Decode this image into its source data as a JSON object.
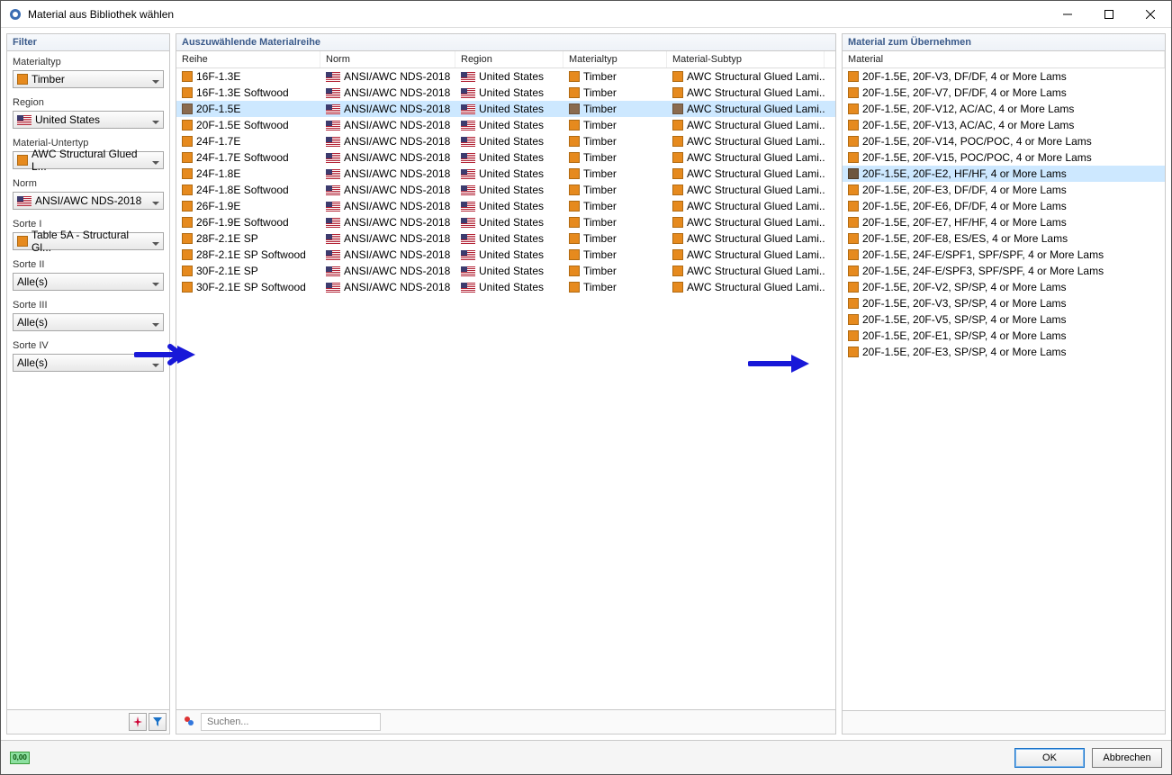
{
  "window": {
    "title": "Material aus Bibliothek wählen"
  },
  "filter": {
    "header": "Filter",
    "materialtyp_label": "Materialtyp",
    "materialtyp_value": "Timber",
    "region_label": "Region",
    "region_value": "United States",
    "subtyp_label": "Material-Untertyp",
    "subtyp_value": "AWC Structural Glued L...",
    "norm_label": "Norm",
    "norm_value": "ANSI/AWC NDS-2018",
    "sorte1_label": "Sorte I",
    "sorte1_value": "Table 5A - Structural Gl...",
    "sorte2_label": "Sorte II",
    "sorte2_value": "Alle(s)",
    "sorte3_label": "Sorte III",
    "sorte3_value": "Alle(s)",
    "sorte4_label": "Sorte IV",
    "sorte4_value": "Alle(s)"
  },
  "series": {
    "header": "Auszuwählende Materialreihe",
    "columns": {
      "reihe": "Reihe",
      "norm": "Norm",
      "region": "Region",
      "typ": "Materialtyp",
      "subtyp": "Material-Subtyp"
    },
    "rows": [
      {
        "reihe": "16F-1.3E",
        "norm": "ANSI/AWC NDS-2018",
        "region": "United States",
        "typ": "Timber",
        "subtyp": "AWC Structural Glued Lami...",
        "selected": false
      },
      {
        "reihe": "16F-1.3E Softwood",
        "norm": "ANSI/AWC NDS-2018",
        "region": "United States",
        "typ": "Timber",
        "subtyp": "AWC Structural Glued Lami...",
        "selected": false
      },
      {
        "reihe": "20F-1.5E",
        "norm": "ANSI/AWC NDS-2018",
        "region": "United States",
        "typ": "Timber",
        "subtyp": "AWC Structural Glued Lami...",
        "selected": true
      },
      {
        "reihe": "20F-1.5E Softwood",
        "norm": "ANSI/AWC NDS-2018",
        "region": "United States",
        "typ": "Timber",
        "subtyp": "AWC Structural Glued Lami...",
        "selected": false
      },
      {
        "reihe": "24F-1.7E",
        "norm": "ANSI/AWC NDS-2018",
        "region": "United States",
        "typ": "Timber",
        "subtyp": "AWC Structural Glued Lami...",
        "selected": false
      },
      {
        "reihe": "24F-1.7E Softwood",
        "norm": "ANSI/AWC NDS-2018",
        "region": "United States",
        "typ": "Timber",
        "subtyp": "AWC Structural Glued Lami...",
        "selected": false
      },
      {
        "reihe": "24F-1.8E",
        "norm": "ANSI/AWC NDS-2018",
        "region": "United States",
        "typ": "Timber",
        "subtyp": "AWC Structural Glued Lami...",
        "selected": false
      },
      {
        "reihe": "24F-1.8E Softwood",
        "norm": "ANSI/AWC NDS-2018",
        "region": "United States",
        "typ": "Timber",
        "subtyp": "AWC Structural Glued Lami...",
        "selected": false
      },
      {
        "reihe": "26F-1.9E",
        "norm": "ANSI/AWC NDS-2018",
        "region": "United States",
        "typ": "Timber",
        "subtyp": "AWC Structural Glued Lami...",
        "selected": false
      },
      {
        "reihe": "26F-1.9E Softwood",
        "norm": "ANSI/AWC NDS-2018",
        "region": "United States",
        "typ": "Timber",
        "subtyp": "AWC Structural Glued Lami...",
        "selected": false
      },
      {
        "reihe": "28F-2.1E SP",
        "norm": "ANSI/AWC NDS-2018",
        "region": "United States",
        "typ": "Timber",
        "subtyp": "AWC Structural Glued Lami...",
        "selected": false
      },
      {
        "reihe": "28F-2.1E SP Softwood",
        "norm": "ANSI/AWC NDS-2018",
        "region": "United States",
        "typ": "Timber",
        "subtyp": "AWC Structural Glued Lami...",
        "selected": false
      },
      {
        "reihe": "30F-2.1E SP",
        "norm": "ANSI/AWC NDS-2018",
        "region": "United States",
        "typ": "Timber",
        "subtyp": "AWC Structural Glued Lami...",
        "selected": false
      },
      {
        "reihe": "30F-2.1E SP Softwood",
        "norm": "ANSI/AWC NDS-2018",
        "region": "United States",
        "typ": "Timber",
        "subtyp": "AWC Structural Glued Lami...",
        "selected": false
      }
    ],
    "search_placeholder": "Suchen..."
  },
  "materials": {
    "header": "Material zum Übernehmen",
    "column": "Material",
    "rows": [
      {
        "name": "20F-1.5E, 20F-V3, DF/DF, 4 or More Lams",
        "selected": false
      },
      {
        "name": "20F-1.5E, 20F-V7, DF/DF, 4 or More Lams",
        "selected": false
      },
      {
        "name": "20F-1.5E, 20F-V12, AC/AC, 4 or More Lams",
        "selected": false
      },
      {
        "name": "20F-1.5E, 20F-V13, AC/AC, 4 or More Lams",
        "selected": false
      },
      {
        "name": "20F-1.5E, 20F-V14, POC/POC, 4 or More Lams",
        "selected": false
      },
      {
        "name": "20F-1.5E, 20F-V15, POC/POC, 4 or More Lams",
        "selected": false
      },
      {
        "name": "20F-1.5E, 20F-E2, HF/HF, 4 or More Lams",
        "selected": true
      },
      {
        "name": "20F-1.5E, 20F-E3, DF/DF, 4 or More Lams",
        "selected": false
      },
      {
        "name": "20F-1.5E, 20F-E6, DF/DF, 4 or More Lams",
        "selected": false
      },
      {
        "name": "20F-1.5E, 20F-E7, HF/HF, 4 or More Lams",
        "selected": false
      },
      {
        "name": "20F-1.5E, 20F-E8, ES/ES, 4 or More Lams",
        "selected": false
      },
      {
        "name": "20F-1.5E, 24F-E/SPF1, SPF/SPF, 4 or More Lams",
        "selected": false
      },
      {
        "name": "20F-1.5E, 24F-E/SPF3, SPF/SPF, 4 or More Lams",
        "selected": false
      },
      {
        "name": "20F-1.5E, 20F-V2, SP/SP, 4 or More Lams",
        "selected": false
      },
      {
        "name": "20F-1.5E, 20F-V3, SP/SP, 4 or More Lams",
        "selected": false
      },
      {
        "name": "20F-1.5E, 20F-V5, SP/SP, 4 or More Lams",
        "selected": false
      },
      {
        "name": "20F-1.5E, 20F-E1, SP/SP, 4 or More Lams",
        "selected": false
      },
      {
        "name": "20F-1.5E, 20F-E3, SP/SP, 4 or More Lams",
        "selected": false
      }
    ]
  },
  "footer": {
    "ok": "OK",
    "cancel": "Abbrechen",
    "unit_badge": "0,00"
  }
}
